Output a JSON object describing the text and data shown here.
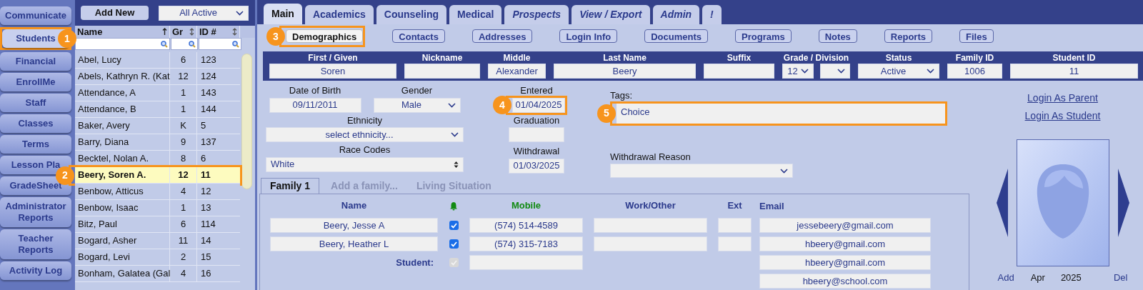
{
  "nav": [
    {
      "label": "Communicate",
      "selected": false
    },
    {
      "label": "Students",
      "selected": true,
      "callout": "1"
    },
    {
      "label": "Financial",
      "selected": false
    },
    {
      "label": "EnrollMe",
      "selected": false
    },
    {
      "label": "Staff",
      "selected": false
    },
    {
      "label": "Classes",
      "selected": false
    },
    {
      "label": "Terms",
      "selected": false
    },
    {
      "label": "Lesson Pla",
      "selected": false
    },
    {
      "label": "GradeSheet",
      "selected": false
    },
    {
      "label": "Administrator Reports",
      "selected": false
    },
    {
      "label": "Teacher Reports",
      "selected": false
    },
    {
      "label": "Activity Log",
      "selected": false
    }
  ],
  "student_list": {
    "add_button": "Add New",
    "filter": "All Active",
    "columns": [
      {
        "label": "Name",
        "sorted": true
      },
      {
        "label": "Gr",
        "sorted": false
      },
      {
        "label": "ID #",
        "sorted": false
      }
    ],
    "rows": [
      {
        "name": "Abel, Lucy",
        "grade": "6",
        "id": "123",
        "selected": false
      },
      {
        "name": "Abels, Kathryn R. (Kat",
        "grade": "12",
        "id": "124",
        "selected": false
      },
      {
        "name": "Attendance, A",
        "grade": "1",
        "id": "143",
        "selected": false
      },
      {
        "name": "Attendance, B",
        "grade": "1",
        "id": "144",
        "selected": false
      },
      {
        "name": "Baker, Avery",
        "grade": "K",
        "id": "5",
        "selected": false
      },
      {
        "name": "Barry, Diana",
        "grade": "9",
        "id": "137",
        "selected": false
      },
      {
        "name": "Becktel, Nolan A.",
        "grade": "8",
        "id": "6",
        "selected": false
      },
      {
        "name": "Beery, Soren A.",
        "grade": "12",
        "id": "11",
        "selected": true,
        "callout": "2"
      },
      {
        "name": "Benbow, Atticus",
        "grade": "4",
        "id": "12",
        "selected": false
      },
      {
        "name": "Benbow, Isaac",
        "grade": "1",
        "id": "13",
        "selected": false
      },
      {
        "name": "Bitz, Paul",
        "grade": "6",
        "id": "114",
        "selected": false
      },
      {
        "name": "Bogard, Asher",
        "grade": "11",
        "id": "14",
        "selected": false
      },
      {
        "name": "Bogard, Levi",
        "grade": "2",
        "id": "15",
        "selected": false
      },
      {
        "name": "Bonham, Galatea (Gal",
        "grade": "4",
        "id": "16",
        "selected": false
      }
    ]
  },
  "tabs": [
    {
      "label": "Main",
      "selected": true,
      "italic": false
    },
    {
      "label": "Academics",
      "selected": false,
      "italic": false
    },
    {
      "label": "Counseling",
      "selected": false,
      "italic": false
    },
    {
      "label": "Medical",
      "selected": false,
      "italic": false
    },
    {
      "label": "Prospects",
      "selected": false,
      "italic": true
    },
    {
      "label": "View / Export",
      "selected": false,
      "italic": true
    },
    {
      "label": "Admin",
      "selected": false,
      "italic": true
    },
    {
      "label": "!",
      "selected": false,
      "italic": true
    }
  ],
  "subtabs": [
    {
      "label": "Demographics",
      "selected": true,
      "callout": "3"
    },
    {
      "label": "Contacts",
      "selected": false
    },
    {
      "label": "Addresses",
      "selected": false
    },
    {
      "label": "Login Info",
      "selected": false
    },
    {
      "label": "Documents",
      "selected": false
    },
    {
      "label": "Programs",
      "selected": false
    },
    {
      "label": "Notes",
      "selected": false
    },
    {
      "label": "Reports",
      "selected": false
    },
    {
      "label": "Files",
      "selected": false
    }
  ],
  "name_fields": [
    {
      "label": "First / Given",
      "kind": "text",
      "value": "Soren"
    },
    {
      "label": "Nickname",
      "kind": "text"
    },
    {
      "label": "Middle",
      "kind": "text",
      "value": "Alexander"
    },
    {
      "label": "Last Name",
      "kind": "text",
      "value": "Beery"
    },
    {
      "label": "Suffix",
      "kind": "text"
    },
    {
      "label": "Grade / Division",
      "kind": "double_select",
      "value": "12"
    },
    {
      "label": "Status",
      "kind": "select",
      "value": "Active"
    },
    {
      "label": "Family ID",
      "kind": "text",
      "value": "1006"
    },
    {
      "label": "Student ID",
      "kind": "text",
      "value": "11"
    }
  ],
  "demographics": {
    "date_of_birth": {
      "label": "Date of Birth",
      "value": "09/11/2011"
    },
    "gender": {
      "label": "Gender",
      "value": "Male"
    },
    "ethnicity": {
      "label": "Ethnicity",
      "value": "select ethnicity..."
    },
    "race_codes": {
      "label": "Race Codes",
      "value": "White"
    },
    "entered": {
      "label": "Entered",
      "value": "01/04/2025",
      "callout": "4"
    },
    "graduation": {
      "label": "Graduation"
    },
    "withdrawal": {
      "label": "Withdrawal",
      "value": "01/03/2025"
    },
    "tags": {
      "label": "Tags:",
      "value": "Choice",
      "callout": "5"
    },
    "withdrawal_reason": {
      "label": "Withdrawal Reason"
    }
  },
  "login_links": [
    "Login As Parent",
    "Login As Student"
  ],
  "photo": {
    "add": "Add",
    "month": "Apr",
    "year": "2025",
    "delete": "Del"
  },
  "family": {
    "tabs": [
      {
        "label": "Family 1",
        "selected": true
      },
      {
        "label": "Add a family...",
        "selected": false
      },
      {
        "label": "Living Situation",
        "selected": false
      }
    ],
    "columns": [
      {
        "label": "Name"
      },
      {
        "label": "Mobile",
        "color": "#118a11"
      },
      {
        "label": "Work/Other"
      },
      {
        "label": "Ext"
      },
      {
        "label": "Email"
      }
    ],
    "rows": [
      {
        "kind": "contact",
        "name": "Beery, Jesse A",
        "notify": true,
        "disabled": false,
        "mobile": "(574) 514-4589",
        "email": "jessebeery@gmail.com"
      },
      {
        "kind": "contact",
        "name": "Beery, Heather L",
        "notify": true,
        "disabled": false,
        "mobile": "(574) 315-7183",
        "email": "hbeery@gmail.com"
      },
      {
        "kind": "student",
        "label": "Student:",
        "notify": true,
        "disabled": true,
        "email": "hbeery@gmail.com"
      },
      {
        "kind": "email_only",
        "email": "hbeery@school.com"
      }
    ]
  }
}
